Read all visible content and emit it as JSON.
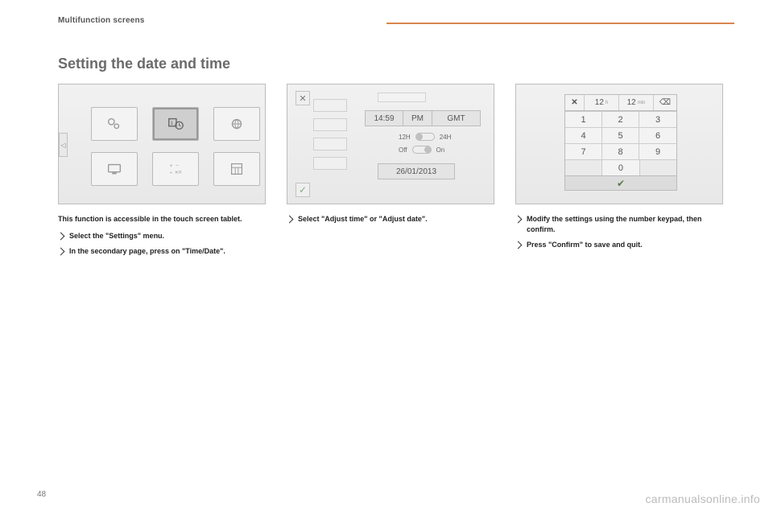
{
  "header": {
    "section": "Multifunction screens"
  },
  "title": "Setting the date and time",
  "page_number": "48",
  "watermark": "carmanualsonline.info",
  "col1": {
    "lead": "This function is accessible in the touch screen tablet.",
    "bullets": [
      "Select the \"Settings\" menu.",
      "In the secondary page, press on \"Time/Date\"."
    ]
  },
  "col2": {
    "bullets": [
      "Select \"Adjust time\" or \"Adjust date\"."
    ],
    "time": "14:59",
    "ampm": "PM",
    "tz": "GMT",
    "fmt_left": "12H",
    "fmt_right": "24H",
    "sync_left": "Off",
    "sync_right": "On",
    "date": "26/01/2013"
  },
  "col3": {
    "bullets": [
      "Modify the settings using the number keypad, then confirm.",
      "Press \"Confirm\" to save and quit."
    ],
    "close": "✕",
    "hours": "12",
    "h_unit": "h",
    "mins": "12",
    "m_unit": "min",
    "backspace": "⌫",
    "keys": [
      "1",
      "2",
      "3",
      "4",
      "5",
      "6",
      "7",
      "8",
      "9"
    ],
    "zero": "0",
    "ok": "✔"
  }
}
